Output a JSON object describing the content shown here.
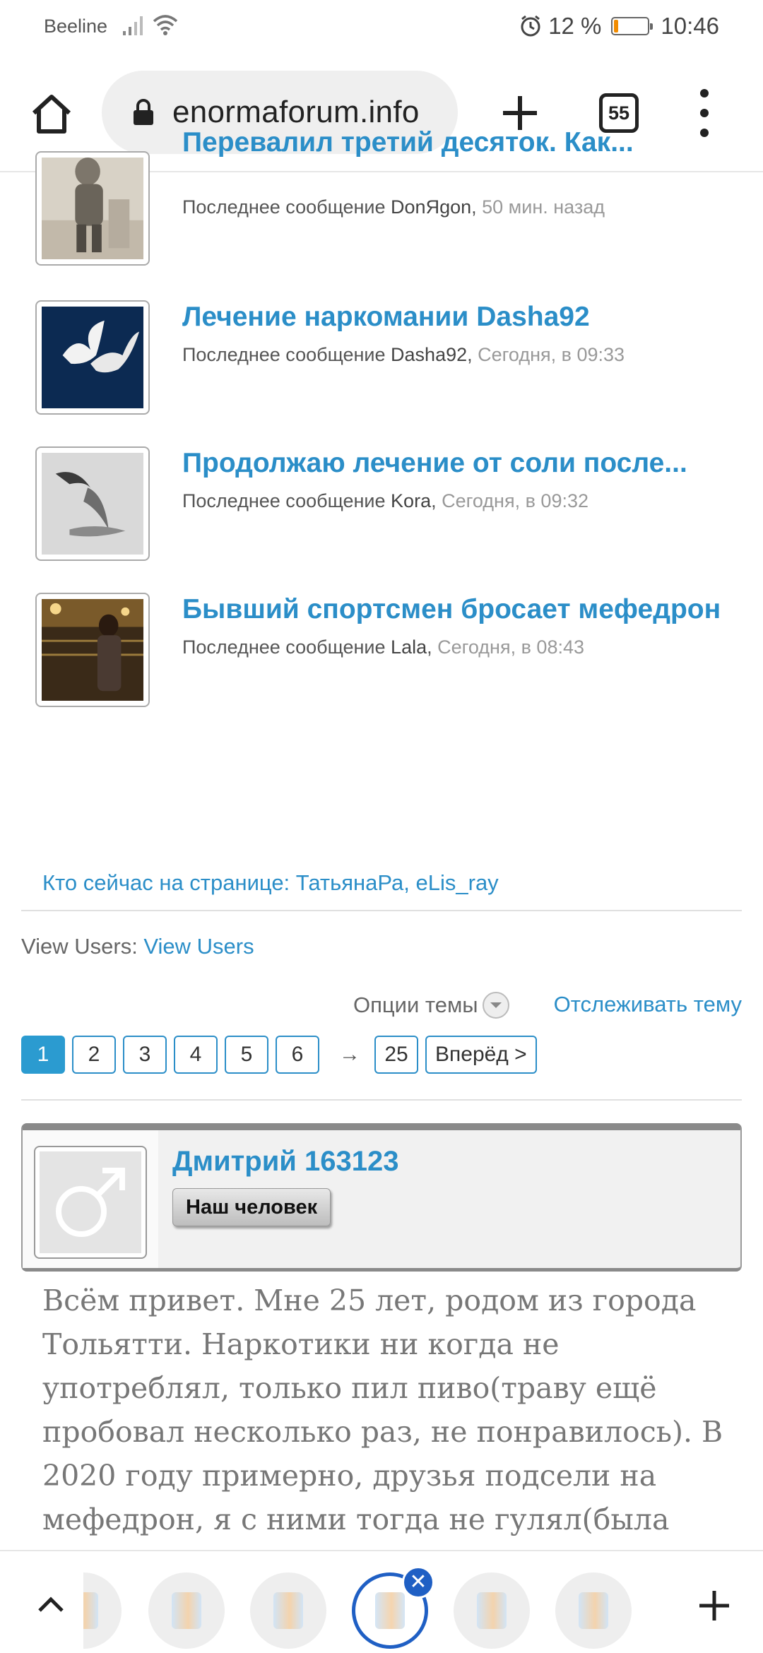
{
  "status_bar": {
    "carrier": "Beeline",
    "battery_percent": "12 %",
    "battery_level": 0.12,
    "time": "10:46"
  },
  "browser": {
    "url": "enormaforum.info",
    "tab_count": "55"
  },
  "threads": [
    {
      "title": "Перевалил третий десяток. Как...",
      "prefix": "Последнее сообщение ",
      "user": "DonЯgon",
      "time": "50 мин. назад",
      "thumb": "child-photo"
    },
    {
      "title": "Лечение наркомании Dasha92",
      "prefix": "Последнее сообщение ",
      "user": "Dasha92",
      "time": "Сегодня, в 09:33",
      "thumb": "doves-photo"
    },
    {
      "title": "Продолжаю лечение от соли после...",
      "prefix": "Последнее сообщение ",
      "user": "Kora",
      "time": "Сегодня, в 09:32",
      "thumb": "bird-photo"
    },
    {
      "title": "Бывший спортсмен бросает мефедрон",
      "prefix": "Последнее сообщение ",
      "user": "Lala",
      "time": "Сегодня, в 08:43",
      "thumb": "person-photo"
    }
  ],
  "viewers": {
    "label": "Кто сейчас на странице: ",
    "users": "ТатьянаРа, eLis_ray"
  },
  "view_users": {
    "label": "View Users: ",
    "link": "View Users"
  },
  "topic_options": "Опции темы",
  "follow_topic": "Отслеживать тему",
  "pagination": {
    "pages": [
      "1",
      "2",
      "3",
      "4",
      "5",
      "6"
    ],
    "current": "1",
    "arrow": "→",
    "last": "25",
    "next": "Вперёд >"
  },
  "post": {
    "author": "Дмитрий 163123",
    "rank": "Наш человек",
    "text": "Всём привет. Мне 25 лет, родом из города Тольятти. Наркотики ни когда не употреблял, только пил пиво(траву ещё пробовал несколько раз, не понравилось). В 2020 году примерно, друзья подсели на мефедрон, я с ними тогда не гулял(была"
  },
  "colors": {
    "link": "#2b8ec8",
    "active_page": "#2b9bd0",
    "tab_accent": "#1f5fc4",
    "battery_low": "#f28c00"
  }
}
